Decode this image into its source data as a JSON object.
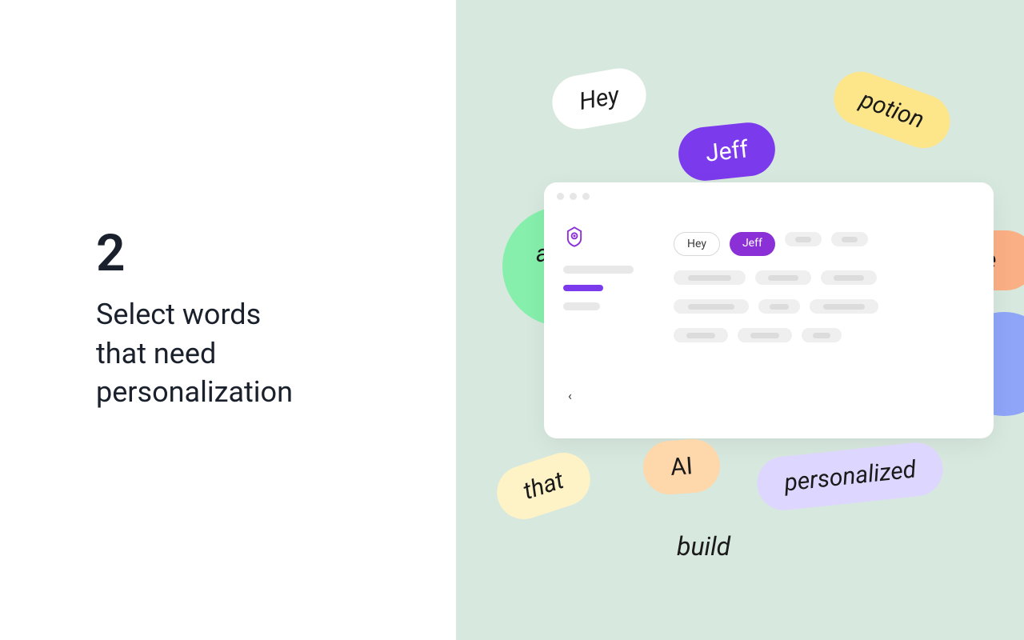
{
  "step": {
    "number": "2",
    "title_line1": "Select words",
    "title_line2": "that need",
    "title_line3": "personalization"
  },
  "bubbles": {
    "hey": "Hey",
    "jeff": "Jeff",
    "potion": "potion",
    "a": "a",
    "e": "e",
    "that": "that",
    "ai": "AI",
    "personalized": "personalized",
    "build": "build"
  },
  "app": {
    "chips": {
      "hey": "Hey",
      "jeff": "Jeff"
    },
    "handle": "‹"
  },
  "colors": {
    "accent": "#7c3aed",
    "bg_mint": "#d7e8de"
  }
}
